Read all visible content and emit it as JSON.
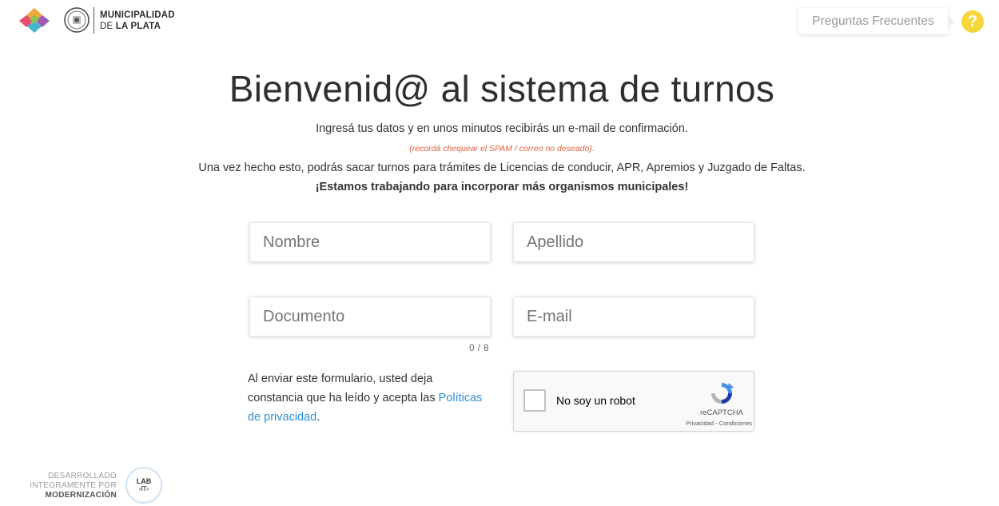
{
  "header": {
    "org_line1": "MUNICIPALIDAD",
    "org_line2_prefix": "DE",
    "org_line2_bold": "LA PLATA",
    "faq_label": "Preguntas Frecuentes",
    "faq_icon_glyph": "?"
  },
  "main": {
    "title": "Bienvenid@ al sistema de turnos",
    "subtitle": "Ingresá tus datos y en unos minutos recibirás un e-mail de confirmación.",
    "spam_note": "(recordá chequear el SPAM / correo no deseado).",
    "info": "Una vez hecho esto, podrás sacar turnos para trámites de Licencias de conducir, APR, Apremios y Juzgado de Faltas.",
    "highlight": "¡Estamos trabajando para incorporar más organismos municipales!"
  },
  "form": {
    "nombre_placeholder": "Nombre",
    "nombre_value": "",
    "apellido_placeholder": "Apellido",
    "apellido_value": "",
    "documento_placeholder": "Documento",
    "documento_value": "",
    "documento_counter": "0 / 8",
    "email_placeholder": "E-mail",
    "email_value": "",
    "legal_text": "Al enviar este formulario, usted deja constancia que ha leído y acepta las ",
    "legal_link": "Políticas de privacidad",
    "legal_end": "."
  },
  "captcha": {
    "label": "No soy un robot",
    "brand": "reCAPTCHA",
    "links": "Privacidad - Condiciones"
  },
  "footer": {
    "dev_line1": "DESARROLLADO",
    "dev_line2": "INTEGRAMENTE POR",
    "dev_line3": "MODERNIZACIÓN",
    "lab_top": "LAB",
    "lab_bottom": "‹IT›"
  },
  "colors": {
    "accent_link": "#2d8fd8",
    "spam_note": "#e0603d",
    "faq_icon": "#f6d63a"
  }
}
